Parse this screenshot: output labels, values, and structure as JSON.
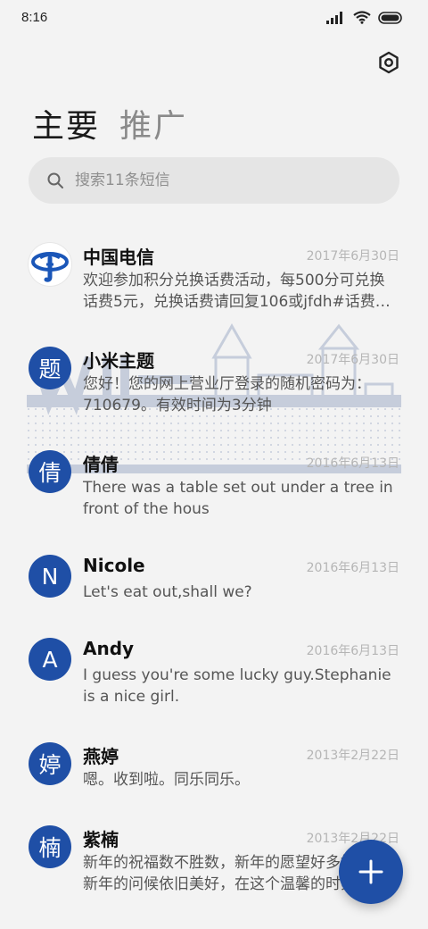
{
  "status_bar": {
    "time": "8:16"
  },
  "tabs": [
    {
      "label": "主要",
      "active": true
    },
    {
      "label": "推广",
      "active": false
    }
  ],
  "search": {
    "placeholder": "搜索11条短信"
  },
  "colors": {
    "accent": "#1f4fa6",
    "background": "#f3f3f3",
    "search_bg": "#e5e5e5"
  },
  "icons": {
    "settings": "hexagon-settings-icon",
    "search": "search-icon",
    "fab": "plus-icon"
  },
  "messages": [
    {
      "avatar": "",
      "avatar_type": "china-telecom-logo",
      "name": "中国电信",
      "date": "2017年6月30日",
      "lines": [
        "欢迎参加积分兑换话费活动，每500分可兑换",
        "话费5元，兑换话费请回复106或jfdh#话费…"
      ]
    },
    {
      "avatar": "题",
      "name": "小米主题",
      "date": "2017年6月30日",
      "lines": [
        "您好！您的网上营业厅登录的随机密码为：",
        "710679。有效时间为3分钟"
      ]
    },
    {
      "avatar": "倩",
      "name": "倩倩",
      "date": "2016年6月13日",
      "lines": [
        "There was a table set out under a tree in",
        "front of the hous"
      ]
    },
    {
      "avatar": "N",
      "name": "Nicole",
      "date": "2016年6月13日",
      "lines": [
        "Let's eat out,shall we?"
      ]
    },
    {
      "avatar": "A",
      "name": "Andy",
      "date": "2016年6月13日",
      "lines": [
        "I guess you're some lucky guy.Stephanie",
        "is a nice girl."
      ]
    },
    {
      "avatar": "婷",
      "name": "燕婷",
      "date": "2013年2月22日",
      "lines": [
        "嗯。收到啦。同乐同乐。"
      ]
    },
    {
      "avatar": "楠",
      "name": "紫楠",
      "date": "2013年2月22日",
      "lines": [
        "新年的祝福数不胜数，新年的愿望好多好多",
        "新年的问候依旧美好，在这个温馨的时刻"
      ]
    }
  ]
}
